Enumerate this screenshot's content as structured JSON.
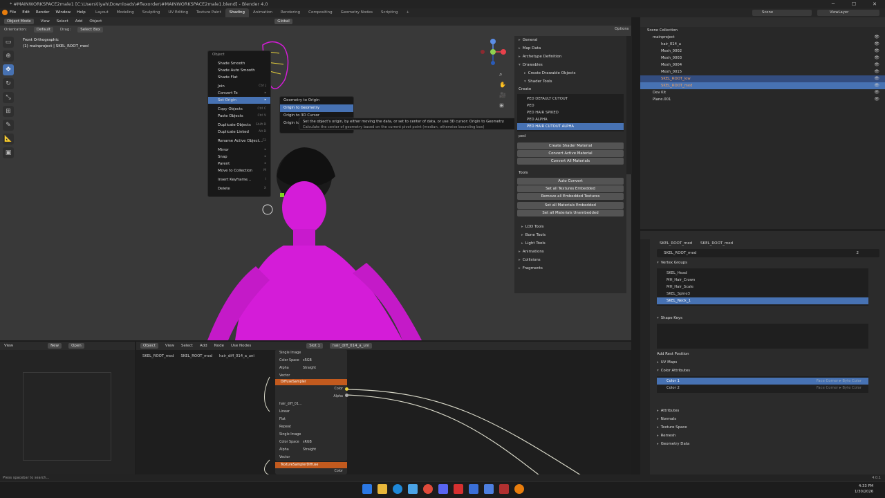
{
  "window": {
    "title": "* #MAINWORKSPACE2male1 [C:\\Users\\liyah\\Downloads\\#flexorder\\#MAINWORKSPACE2male1.blend] - Blender 4.0",
    "minimize": "─",
    "maximize": "☐",
    "close": "✕"
  },
  "menu": [
    "File",
    "Edit",
    "Render",
    "Window",
    "Help"
  ],
  "workspaces": [
    "Layout",
    "Modeling",
    "Sculpting",
    "UV Editing",
    "Texture Paint",
    "Shading",
    "Animation",
    "Rendering",
    "Compositing",
    "Geometry Nodes",
    "Scripting",
    "+"
  ],
  "active_workspace": "Shading",
  "scene": {
    "scene_label": "Scene",
    "view_layer": "ViewLayer"
  },
  "viewport": {
    "mode": "Object Mode",
    "view": "View",
    "select": "Select",
    "add": "Add",
    "object": "Object",
    "transform": "Global",
    "orientation_label": "Orientation:",
    "orientation_value": "Default",
    "drag_label": "Drag:",
    "drag_value": "Select Box",
    "options": "Options",
    "view_name": "Front Orthographic",
    "collection_info": "(1) mainproject | SKEL_ROOT_med"
  },
  "context_menu": {
    "title": "Object",
    "items": [
      {
        "label": "Shade Smooth",
        "shortcut": ""
      },
      {
        "label": "Shade Auto Smooth",
        "shortcut": ""
      },
      {
        "label": "Shade Flat",
        "shortcut": ""
      },
      {
        "label": "Join",
        "shortcut": "Ctrl J"
      },
      {
        "label": "Convert To",
        "shortcut": "▸"
      },
      {
        "label": "Set Origin",
        "shortcut": "▸"
      },
      {
        "label": "Copy Objects",
        "shortcut": "Ctrl C"
      },
      {
        "label": "Paste Objects",
        "shortcut": "Ctrl V"
      },
      {
        "label": "Duplicate Objects",
        "shortcut": "Shift D"
      },
      {
        "label": "Duplicate Linked",
        "shortcut": "Alt D"
      },
      {
        "label": "Rename Active Object...",
        "shortcut": "F2"
      },
      {
        "label": "Mirror",
        "shortcut": "▸"
      },
      {
        "label": "Snap",
        "shortcut": "▸"
      },
      {
        "label": "Parent",
        "shortcut": "▸"
      },
      {
        "label": "Move to Collection",
        "shortcut": "M"
      },
      {
        "label": "Insert Keyframe...",
        "shortcut": "I"
      },
      {
        "label": "Delete",
        "shortcut": "X"
      }
    ]
  },
  "submenu": {
    "items": [
      "Geometry to Origin",
      "Origin to Geometry",
      "Origin to 3D Cursor",
      "Origin to Center of Mass (Volume)"
    ]
  },
  "tooltip": {
    "line1": "Set the object's origin, by either moving the data, or set to center of data, or use 3D cursor:  Origin to Geometry",
    "line2": "Calculate the center of geometry based on the current pivot point (median, otherwise bounding box)"
  },
  "npanel": {
    "sections": [
      "General",
      "Map Data",
      "Archetype Definition",
      "Drawables"
    ],
    "create_drawable": "Create Drawable Objects",
    "shader_tools": "Shader Tools",
    "create_label": "Create",
    "shaders": [
      "PED DEFAULT CUTOUT",
      "PED",
      "PED HAIR SPIKED",
      "PED ALPHA",
      "PED HAIR CUTOUT ALPHA"
    ],
    "search": "ped",
    "create_shader": "Create Shader Material",
    "convert_active": "Convert Active Material",
    "convert_all": "Convert All Materials",
    "tools_label": "Tools",
    "auto_convert": "Auto Convert",
    "set_tex_embedded": "Set all Textures Embedded",
    "remove_tex_embedded": "Remove all Embedded Textures",
    "set_mat_embedded": "Set all Materials Embedded",
    "set_mat_unembedded": "Set all Materials Unembedded",
    "lower": [
      "LOD Tools",
      "Bone Tools",
      "Light Tools",
      "Animations",
      "Collisions",
      "Fragments"
    ],
    "vtabs": [
      "Item",
      "Tool",
      "View",
      "Sollumz Tools",
      "Rmodels"
    ]
  },
  "outliner": {
    "title": "Scene Collection",
    "rows": [
      {
        "label": "mainproject",
        "indent": 1,
        "sel": false
      },
      {
        "label": "hair_014_u",
        "indent": 2,
        "sel": false
      },
      {
        "label": "Mesh_0002",
        "indent": 2,
        "sel": false
      },
      {
        "label": "Mesh_0003",
        "indent": 2,
        "sel": false
      },
      {
        "label": "Mesh_0004",
        "indent": 2,
        "sel": false
      },
      {
        "label": "Mesh_0015",
        "indent": 2,
        "sel": false
      },
      {
        "label": "SKEL_ROOT_low",
        "indent": 2,
        "sel": true
      },
      {
        "label": "SKEL_ROOT_med",
        "indent": 2,
        "sel": true
      },
      {
        "label": "Dev Kit",
        "indent": 1,
        "sel": false
      },
      {
        "label": "Plane.001",
        "indent": 1,
        "sel": false
      }
    ]
  },
  "properties": {
    "breadcrumb_obj": "SKEL_ROOT_med",
    "breadcrumb_data": "SKEL_ROOT_med",
    "mesh_name": "SKEL_ROOT_med",
    "users": "2",
    "vertex_groups_label": "Vertex Groups",
    "vertex_groups": [
      "SKEL_Head",
      "MH_Hair_Crown",
      "MH_Hair_Scale",
      "SKEL_Spine3",
      "SKEL_Neck_1"
    ],
    "shape_keys": "Shape Keys",
    "add_rest": "Add Rest Position",
    "uv_maps": "UV Maps",
    "color_attributes": "Color Attributes",
    "colors": [
      "Color 1",
      "Color 2"
    ],
    "color_domain": "Face Corner ▸ Byte Color",
    "lower": [
      "Attributes",
      "Normals",
      "Texture Space",
      "Remesh",
      "Geometry Data"
    ]
  },
  "node_editor": {
    "view": "View",
    "new": "New",
    "open": "Open",
    "object": "Object",
    "view2": "View",
    "select": "Select",
    "add": "Add",
    "node": "Node",
    "use_nodes": "Use Nodes",
    "slot": "Slot 1",
    "material": "hair_diff_014_a_uni",
    "bc_obj": "SKEL_ROOT_med",
    "bc_mesh": "SKEL_ROOT_med",
    "bc_mat": "hair_diff_014_a_uni",
    "node1_rows": [
      "Single Image",
      "Color Space",
      "Alpha",
      "Vector"
    ],
    "node1_vals": [
      "",
      "sRGB",
      "Straight",
      ""
    ],
    "diffuse_header": "DiffuseSampler",
    "color_out": "Color",
    "alpha_out": "Alpha",
    "img": "hair_diff_01...",
    "node2_rows": [
      "Linear",
      "Flat",
      "Repeat",
      "Single Image",
      "Color Space",
      "Alpha",
      "Vector"
    ],
    "node2_vals": [
      "",
      "",
      "",
      "",
      "sRGB",
      "Straight",
      ""
    ],
    "texture_header": "TextureSamplerDiffuse"
  },
  "status": {
    "left": "Press spacebar to search...",
    "version": "4.0.1"
  },
  "clock": {
    "time": "4:33 PM",
    "date": "1/30/2026"
  },
  "colors": {
    "accent": "#4772b3",
    "magenta": "#d41cd8",
    "node_orange": "#c25a1e"
  }
}
